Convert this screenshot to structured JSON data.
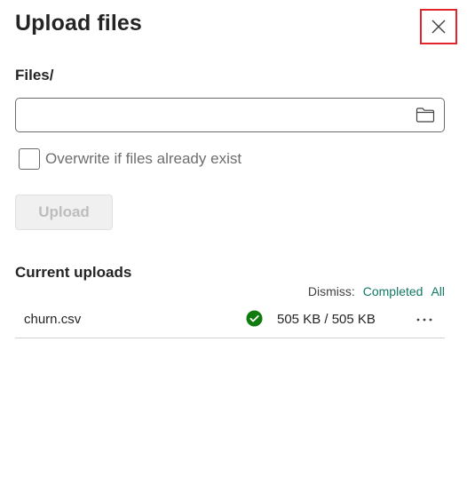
{
  "dialog": {
    "title": "Upload files",
    "close_icon": "close-icon"
  },
  "destination": {
    "path_label": "Files/",
    "input_value": "",
    "input_placeholder": "",
    "browse_icon": "folder-icon"
  },
  "overwrite": {
    "label": "Overwrite if files already exist",
    "checked": false
  },
  "upload_button": {
    "label": "Upload",
    "disabled": true
  },
  "current_uploads": {
    "heading": "Current uploads",
    "dismiss_label": "Dismiss:",
    "dismiss_completed": "Completed",
    "dismiss_all": "All",
    "items": [
      {
        "name": "churn.csv",
        "status": "completed",
        "status_icon": "check-circle-icon",
        "size": "505 KB / 505 KB",
        "more_icon": "more-options-icon"
      }
    ]
  },
  "colors": {
    "link": "#117865",
    "success": "#107c10",
    "close_highlight": "#e3262b"
  }
}
